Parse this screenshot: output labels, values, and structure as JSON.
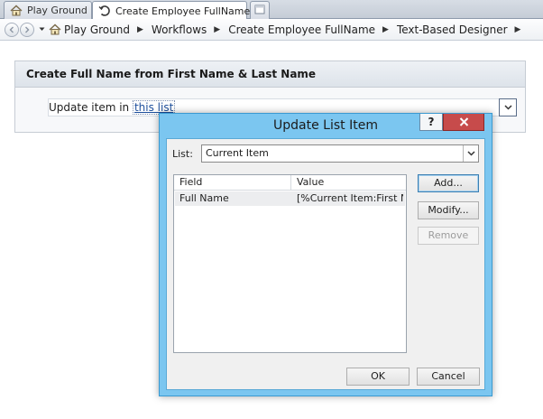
{
  "tabs": [
    {
      "label": "Play Ground",
      "icon": "home-icon"
    },
    {
      "label": "Create Employee FullName *",
      "icon": "workflow-icon"
    }
  ],
  "breadcrumb": [
    "Play Ground",
    "Workflows",
    "Create Employee FullName",
    "Text-Based Designer"
  ],
  "step": {
    "title": "Create Full Name from First Name & Last Name",
    "text": "Update item in",
    "link": "this list"
  },
  "dialog": {
    "title": "Update List Item",
    "help_label": "?",
    "list_label": "List:",
    "list_value": "Current Item",
    "columns": [
      "Field",
      "Value"
    ],
    "rows": [
      {
        "field": "Full Name",
        "value": "[%Current Item:First N..."
      }
    ],
    "buttons": {
      "add": "Add...",
      "modify": "Modify...",
      "remove": "Remove",
      "ok": "OK",
      "cancel": "Cancel"
    }
  },
  "colors": {
    "dialog_frame": "#7bc6f0",
    "close_button": "#c74b4b",
    "link": "#1e4f9c"
  }
}
